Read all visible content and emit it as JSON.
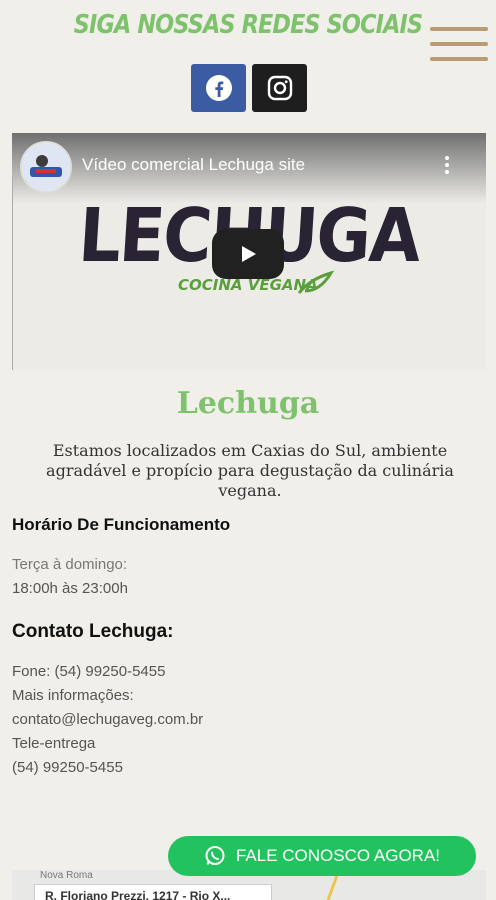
{
  "header": {
    "social_title": "SIGA NOSSAS REDES SOCIAIS",
    "social": [
      {
        "name": "facebook",
        "icon": "facebook-icon",
        "color": "#3b5ba3"
      },
      {
        "name": "instagram",
        "icon": "instagram-icon",
        "color": "#1e1e1e"
      }
    ],
    "menu_icon": "hamburger-menu-icon"
  },
  "video": {
    "title": "Vídeo comercial Lechuga site",
    "logo_text": "LECHUGA",
    "logo_subtitle": "COCINA VEGANA",
    "play_icon": "play-icon",
    "more_icon": "more-vertical-icon"
  },
  "about": {
    "name": "Lechuga",
    "intro": "Estamos localizados em Caxias do Sul, ambiente agradável e propício para degustação da culinária vegana."
  },
  "hours": {
    "title": "Horário De Funcionamento",
    "days": "Terça à domingo:",
    "time": "18:00h às 23:00h"
  },
  "contact": {
    "title": "Contato Lechuga:",
    "lines": [
      "Fone: (54) 99250-5455",
      "Mais informações:",
      "contato@lechugaveg.com.br",
      "Tele-entrega",
      "(54) 99250-5455"
    ]
  },
  "cta": {
    "label": "FALE CONOSCO AGORA!",
    "icon": "whatsapp-icon",
    "color": "#22c25f"
  },
  "map": {
    "area_label": "Nova Roma",
    "address": "R. Floriano Prezzi, 1217 - Rio X..."
  },
  "colors": {
    "accent_green": "#7ec26d",
    "menu_tan": "#b99a75",
    "background": "#f1efe9"
  }
}
